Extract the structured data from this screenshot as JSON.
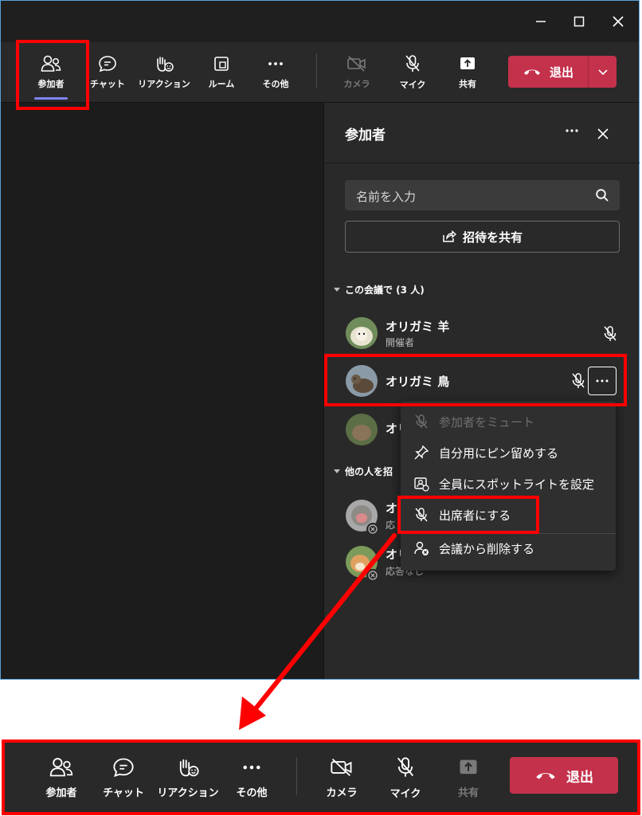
{
  "toolbar": {
    "participants": "参加者",
    "chat": "チャット",
    "reactions": "リアクション",
    "rooms": "ルーム",
    "more": "その他",
    "camera": "カメラ",
    "mic": "マイク",
    "share": "共有",
    "leave": "退出"
  },
  "panel": {
    "title": "参加者",
    "search_placeholder": "名前を入力",
    "share_invite": "招待を共有",
    "in_meeting_label": "この会議で (3 人)",
    "others_label": "他の人を招",
    "people": [
      {
        "name": "オリガミ 羊",
        "role": "開催者"
      },
      {
        "name": "オリガミ 鳥",
        "role": ""
      },
      {
        "name": "オリ",
        "role": ""
      },
      {
        "name": "オリ",
        "role": "応"
      },
      {
        "name": "オリ",
        "role": "応答なし"
      }
    ]
  },
  "context_menu": {
    "mute": "参加者をミュート",
    "pin": "自分用にピン留めする",
    "spotlight": "全員にスポットライトを設定",
    "make_attendee": "出席者にする",
    "remove": "会議から削除する"
  },
  "bottom_bar": {
    "participants": "参加者",
    "chat": "チャット",
    "reactions": "リアクション",
    "more": "その他",
    "camera": "カメラ",
    "mic": "マイク",
    "share": "共有",
    "leave": "退出"
  },
  "colors": {
    "leave_red": "#c4314b",
    "highlight": "#ff0000",
    "accent": "#7f85f5",
    "panel_bg": "#292929"
  }
}
